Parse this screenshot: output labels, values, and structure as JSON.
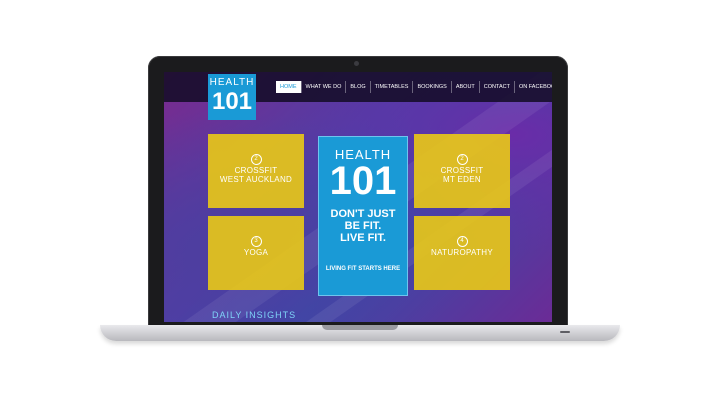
{
  "site": {
    "logo": {
      "line1": "HEALTH",
      "line2": "101"
    },
    "nav": [
      "HOME",
      "WHAT WE DO",
      "BLOG",
      "TIMETABLES",
      "BOOKINGS",
      "ABOUT",
      "CONTACT",
      "ON FACEBOOK"
    ],
    "tiles": [
      {
        "icon": "2",
        "line1": "CROSSFIT",
        "line2": "WEST AUCKLAND"
      },
      {
        "icon": "2",
        "line1": "CROSSFIT",
        "line2": "MT EDEN"
      },
      {
        "icon": "3",
        "line1": "YOGA",
        "line2": ""
      },
      {
        "icon": "4",
        "line1": "NATUROPATHY",
        "line2": ""
      }
    ],
    "center": {
      "heading": "HEALTH",
      "number": "101",
      "slogan1": "DON'T JUST",
      "slogan2": "BE FIT.",
      "slogan3": "LIVE FIT.",
      "sub": "LIVING FIT STARTS HERE"
    },
    "insights": "DAILY INSIGHTS"
  },
  "colors": {
    "accent_blue": "#1a9ad6",
    "tile_yellow": "#eecd12"
  }
}
